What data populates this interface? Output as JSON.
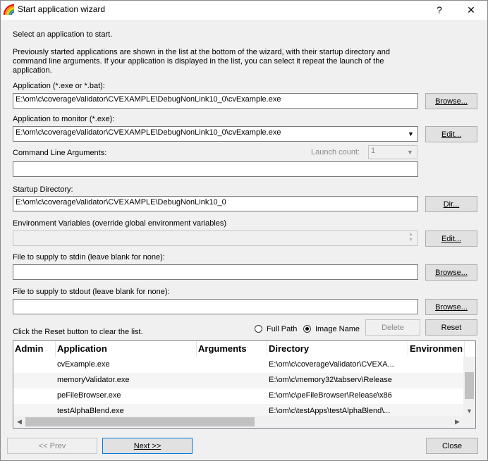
{
  "window": {
    "title": "Start application wizard",
    "help_label": "?",
    "close_label": "✕"
  },
  "intro": {
    "line1": "Select an application to start.",
    "line2": "Previously started applications are shown in the list at the bottom of the wizard, with their startup directory and",
    "line3": "command line arguments. If your application is displayed in the list, you can select it repeat the launch of the",
    "line4": "application."
  },
  "application": {
    "label": "Application (*.exe or *.bat):",
    "value": "E:\\om\\c\\coverageValidator\\CVEXAMPLE\\DebugNonLink10_0\\cvExample.exe",
    "button": "Browse..."
  },
  "monitor": {
    "label": "Application to monitor (*.exe):",
    "value": "E:\\om\\c\\coverageValidator\\CVEXAMPLE\\DebugNonLink10_0\\cvExample.exe",
    "button": "Edit..."
  },
  "arguments": {
    "label": "Command Line Arguments:",
    "value": "",
    "launch_count_label": "Launch count:",
    "launch_count_value": "1"
  },
  "startup_dir": {
    "label": "Startup Directory:",
    "value": "E:\\om\\c\\coverageValidator\\CVEXAMPLE\\DebugNonLink10_0",
    "button": "Dir..."
  },
  "env": {
    "label": "Environment Variables (override global environment variables)",
    "value": "",
    "button": "Edit..."
  },
  "stdin": {
    "label": "File to supply to stdin (leave blank for none):",
    "value": "",
    "button": "Browse..."
  },
  "stdout": {
    "label": "File to supply to stdout (leave blank for none):",
    "value": "",
    "button": "Browse..."
  },
  "list_controls": {
    "reset_hint": "Click the Reset button to clear the list.",
    "full_path": "Full Path",
    "image_name": "Image Name",
    "selected": "image_name",
    "delete_button": "Delete",
    "reset_button": "Reset"
  },
  "history": {
    "columns": [
      "Admin",
      "Application",
      "Arguments",
      "Directory",
      "Environmen"
    ],
    "rows": [
      {
        "admin": "",
        "application": "cvExample.exe",
        "arguments": "",
        "directory": "E:\\om\\c\\coverageValidator\\CVEXA..."
      },
      {
        "admin": "",
        "application": "memoryValidator.exe",
        "arguments": "",
        "directory": "E:\\om\\c\\memory32\\tabserv\\Release"
      },
      {
        "admin": "",
        "application": "peFileBrowser.exe",
        "arguments": "",
        "directory": "E:\\om\\c\\peFileBrowser\\Release\\x86"
      },
      {
        "admin": "",
        "application": "testAlphaBlend.exe",
        "arguments": "",
        "directory": "E:\\om\\c\\testApps\\testAlphaBlend\\..."
      }
    ]
  },
  "footer": {
    "prev": "<< Prev",
    "next": "Next >>",
    "close": "Close"
  }
}
